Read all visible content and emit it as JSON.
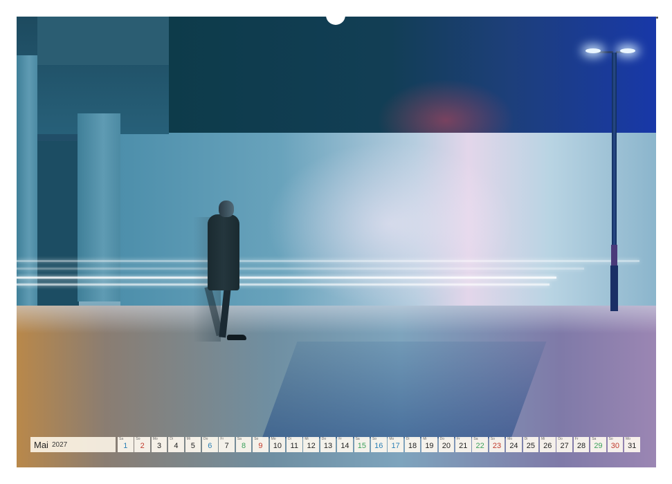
{
  "calendar": {
    "month": "Mai",
    "year": "2027",
    "colors": {
      "weekday": "#222222",
      "saturday": "#2a7fb5",
      "sunday": "#c0392b",
      "holiday": "#3aa05a"
    },
    "days": [
      {
        "num": "1",
        "abbr": "Sa",
        "kind": "saturday"
      },
      {
        "num": "2",
        "abbr": "So",
        "kind": "sunday"
      },
      {
        "num": "3",
        "abbr": "Mo",
        "kind": "weekday"
      },
      {
        "num": "4",
        "abbr": "Di",
        "kind": "weekday"
      },
      {
        "num": "5",
        "abbr": "Mi",
        "kind": "weekday"
      },
      {
        "num": "6",
        "abbr": "Do",
        "kind": "saturday"
      },
      {
        "num": "7",
        "abbr": "Fr",
        "kind": "weekday"
      },
      {
        "num": "8",
        "abbr": "Sa",
        "kind": "holiday"
      },
      {
        "num": "9",
        "abbr": "So",
        "kind": "sunday"
      },
      {
        "num": "10",
        "abbr": "Mo",
        "kind": "weekday"
      },
      {
        "num": "11",
        "abbr": "Di",
        "kind": "weekday"
      },
      {
        "num": "12",
        "abbr": "Mi",
        "kind": "weekday"
      },
      {
        "num": "13",
        "abbr": "Do",
        "kind": "weekday"
      },
      {
        "num": "14",
        "abbr": "Fr",
        "kind": "weekday"
      },
      {
        "num": "15",
        "abbr": "Sa",
        "kind": "holiday"
      },
      {
        "num": "16",
        "abbr": "So",
        "kind": "saturday"
      },
      {
        "num": "17",
        "abbr": "Mo",
        "kind": "saturday"
      },
      {
        "num": "18",
        "abbr": "Di",
        "kind": "weekday"
      },
      {
        "num": "19",
        "abbr": "Mi",
        "kind": "weekday"
      },
      {
        "num": "20",
        "abbr": "Do",
        "kind": "weekday"
      },
      {
        "num": "21",
        "abbr": "Fr",
        "kind": "weekday"
      },
      {
        "num": "22",
        "abbr": "Sa",
        "kind": "holiday"
      },
      {
        "num": "23",
        "abbr": "So",
        "kind": "sunday"
      },
      {
        "num": "24",
        "abbr": "Mo",
        "kind": "weekday"
      },
      {
        "num": "25",
        "abbr": "Di",
        "kind": "weekday"
      },
      {
        "num": "26",
        "abbr": "Mi",
        "kind": "weekday"
      },
      {
        "num": "27",
        "abbr": "Do",
        "kind": "weekday"
      },
      {
        "num": "28",
        "abbr": "Fr",
        "kind": "weekday"
      },
      {
        "num": "29",
        "abbr": "Sa",
        "kind": "holiday"
      },
      {
        "num": "30",
        "abbr": "So",
        "kind": "sunday"
      },
      {
        "num": "31",
        "abbr": "Mo",
        "kind": "weekday"
      }
    ]
  }
}
